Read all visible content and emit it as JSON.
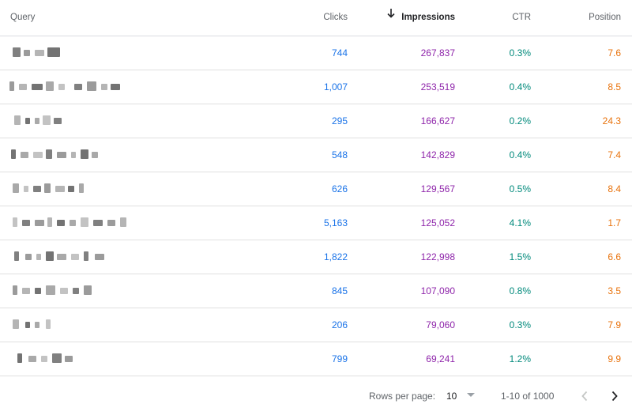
{
  "table": {
    "headers": {
      "query": "Query",
      "clicks": "Clicks",
      "impressions": "Impressions",
      "ctr": "CTR",
      "position": "Position"
    },
    "sorted_column": "impressions",
    "sort_direction": "descending",
    "sort_icon": "arrow-down-icon",
    "rows": [
      {
        "clicks": "744",
        "impressions": "267,837",
        "ctr": "0.3%",
        "position": "7.6"
      },
      {
        "clicks": "1,007",
        "impressions": "253,519",
        "ctr": "0.4%",
        "position": "8.5"
      },
      {
        "clicks": "295",
        "impressions": "166,627",
        "ctr": "0.2%",
        "position": "24.3"
      },
      {
        "clicks": "548",
        "impressions": "142,829",
        "ctr": "0.4%",
        "position": "7.4"
      },
      {
        "clicks": "626",
        "impressions": "129,567",
        "ctr": "0.5%",
        "position": "8.4"
      },
      {
        "clicks": "5,163",
        "impressions": "125,052",
        "ctr": "4.1%",
        "position": "1.7"
      },
      {
        "clicks": "1,822",
        "impressions": "122,998",
        "ctr": "1.5%",
        "position": "6.6"
      },
      {
        "clicks": "845",
        "impressions": "107,090",
        "ctr": "0.8%",
        "position": "3.5"
      },
      {
        "clicks": "206",
        "impressions": "79,060",
        "ctr": "0.3%",
        "position": "7.9"
      },
      {
        "clicks": "799",
        "impressions": "69,241",
        "ctr": "1.2%",
        "position": "9.9"
      }
    ]
  },
  "colors": {
    "clicks": "#1a73e8",
    "impressions": "#8e24aa",
    "ctr": "#00897b",
    "position": "#e8710a"
  },
  "pagination": {
    "rows_per_page_label": "Rows per page:",
    "rows_per_page_value": "10",
    "range_text": "1-10 of 1000",
    "dropdown_icon": "triangle-down-icon",
    "prev_icon": "chevron-left-icon",
    "next_icon": "chevron-right-icon"
  }
}
